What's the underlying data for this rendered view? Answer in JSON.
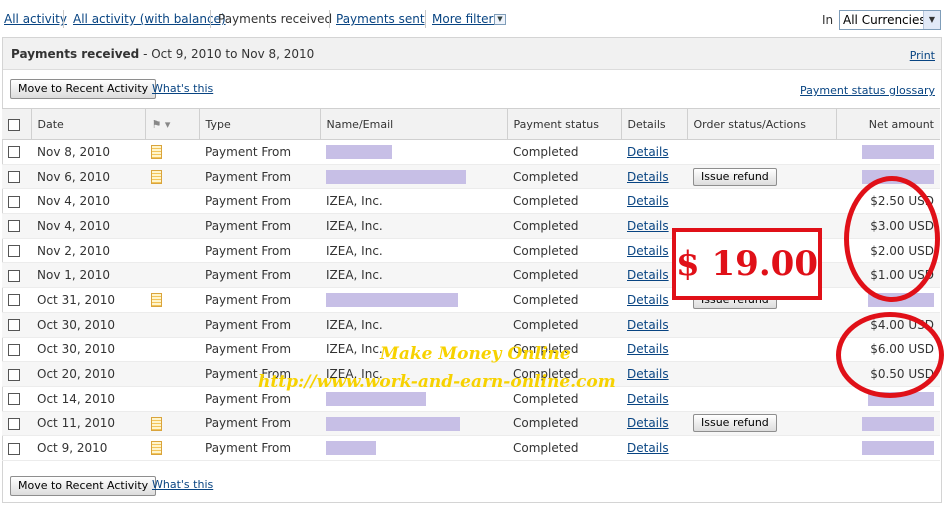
{
  "top_nav": {
    "tabs": [
      "All activity",
      "All activity (with balance)",
      "Payments received",
      "Payments sent",
      "More filters"
    ],
    "in_label": "In",
    "currency": "All Currencies"
  },
  "panel": {
    "title": "Payments received",
    "date_range": "- Oct 9, 2010 to Nov 8, 2010",
    "print": "Print",
    "move_button": "Move to Recent Activity",
    "whats_this": "What's this",
    "glossary": "Payment status glossary"
  },
  "table": {
    "headers": [
      "Date",
      "Type",
      "Name/Email",
      "Payment status",
      "Details",
      "Order status/Actions",
      "Net amount"
    ],
    "rows": [
      {
        "date": "Nov 8, 2010",
        "note": true,
        "type": "Payment From",
        "name": "",
        "name_w": 66,
        "status": "Completed",
        "details": "Details",
        "action": "",
        "amount": "",
        "amt_w": 72
      },
      {
        "date": "Nov 6, 2010",
        "note": true,
        "type": "Payment From",
        "name": "",
        "name_w": 140,
        "status": "Completed",
        "details": "Details",
        "action": "Issue refund",
        "amount": "",
        "amt_w": 72
      },
      {
        "date": "Nov 4, 2010",
        "note": false,
        "type": "Payment From",
        "name": "IZEA, Inc.",
        "status": "Completed",
        "details": "Details",
        "action": "",
        "amount": "$2.50 USD"
      },
      {
        "date": "Nov 4, 2010",
        "note": false,
        "type": "Payment From",
        "name": "IZEA, Inc.",
        "status": "Completed",
        "details": "Details",
        "action": "",
        "amount": "$3.00 USD"
      },
      {
        "date": "Nov 2, 2010",
        "note": false,
        "type": "Payment From",
        "name": "IZEA, Inc.",
        "status": "Completed",
        "details": "Details",
        "action": "",
        "amount": "$2.00 USD"
      },
      {
        "date": "Nov 1, 2010",
        "note": false,
        "type": "Payment From",
        "name": "IZEA, Inc.",
        "status": "Completed",
        "details": "Details",
        "action": "",
        "amount": "$1.00 USD"
      },
      {
        "date": "Oct 31, 2010",
        "note": true,
        "type": "Payment From",
        "name": "",
        "name_w": 132,
        "status": "Completed",
        "details": "Details",
        "action": "Issue refund",
        "amount": "",
        "amt_w": 66
      },
      {
        "date": "Oct 30, 2010",
        "note": false,
        "type": "Payment From",
        "name": "IZEA, Inc.",
        "status": "Completed",
        "details": "Details",
        "action": "",
        "amount": "$4.00 USD"
      },
      {
        "date": "Oct 30, 2010",
        "note": false,
        "type": "Payment From",
        "name": "IZEA, Inc.",
        "status": "Completed",
        "details": "Details",
        "action": "",
        "amount": "$6.00 USD"
      },
      {
        "date": "Oct 20, 2010",
        "note": false,
        "type": "Payment From",
        "name": "IZEA, Inc.",
        "status": "Completed",
        "details": "Details",
        "action": "",
        "amount": "$0.50 USD"
      },
      {
        "date": "Oct 14, 2010",
        "note": false,
        "type": "Payment From",
        "name": "",
        "name_w": 100,
        "status": "Completed",
        "details": "Details",
        "action": "",
        "amount": "",
        "amt_w": 66
      },
      {
        "date": "Oct 11, 2010",
        "note": true,
        "type": "Payment From",
        "name": "",
        "name_w": 134,
        "status": "Completed",
        "details": "Details",
        "action": "Issue refund",
        "amount": "",
        "amt_w": 72
      },
      {
        "date": "Oct 9, 2010",
        "note": true,
        "type": "Payment From",
        "name": "",
        "name_w": 50,
        "status": "Completed",
        "details": "Details",
        "action": "",
        "amount": "",
        "amt_w": 72
      }
    ]
  },
  "overlay": {
    "total": "$ 19.00",
    "watermark_title": "Make Money Online",
    "watermark_url": "http://www.work-and-earn-online.com"
  }
}
